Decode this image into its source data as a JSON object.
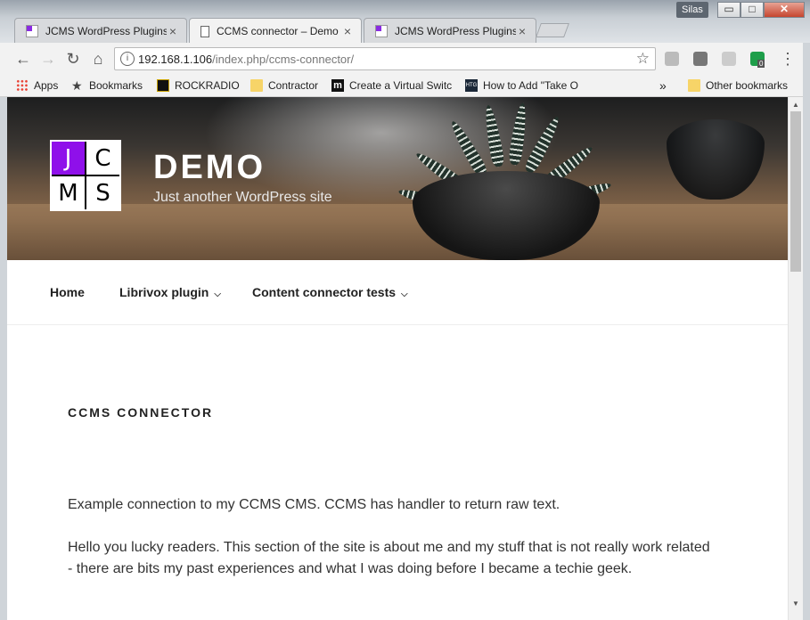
{
  "window": {
    "user_badge": "Silas",
    "controls": {
      "minimize": "▭",
      "maximize": "□",
      "close": "✕"
    }
  },
  "tabs": [
    {
      "title": "JCMS WordPress Plugins",
      "icon": "jcms-favicon",
      "active": false
    },
    {
      "title": "CCMS connector – Demo",
      "icon": "page-icon",
      "active": true
    },
    {
      "title": "JCMS WordPress Plugins",
      "icon": "jcms-favicon",
      "active": false
    }
  ],
  "toolbar": {
    "back": "←",
    "forward": "→",
    "reload": "↻",
    "home": "⌂",
    "url_host": "192.168.1.106",
    "url_path": "/index.php/ccms-connector/",
    "info": "i",
    "star": "☆",
    "menu": "⋮",
    "extensions": [
      "cube-icon",
      "shield-icon",
      "pdf-icon",
      "green-extension-icon"
    ],
    "extension_badge": "0"
  },
  "bookmarks": {
    "items": [
      {
        "label": "Apps",
        "icon": "apps-icon"
      },
      {
        "label": "Bookmarks",
        "icon": "star-icon"
      },
      {
        "label": "ROCKRADIO",
        "icon": "rockradio-icon"
      },
      {
        "label": "Contractor",
        "icon": "folder-icon"
      },
      {
        "label": "Create a Virtual Switc",
        "icon": "m-icon"
      },
      {
        "label": "How to Add \"Take O",
        "icon": "htg-icon"
      }
    ],
    "overflow": "»",
    "other": "Other bookmarks"
  },
  "site": {
    "logo_letters": [
      "J",
      "C",
      "M",
      "S"
    ],
    "title": "DEMO",
    "description": "Just another WordPress site"
  },
  "nav": [
    {
      "label": "Home",
      "has_submenu": false
    },
    {
      "label": "Librivox plugin",
      "has_submenu": true
    },
    {
      "label": "Content connector tests",
      "has_submenu": true
    }
  ],
  "content": {
    "title": "CCMS CONNECTOR",
    "paragraphs": [
      "Example connection to my CCMS CMS. CCMS has handler to return raw text.",
      "Hello you lucky readers. This section of the site is about me and my stuff that is not really work related - there are bits my past experiences and what I was doing before I became a techie geek."
    ]
  },
  "scrollbar": {
    "up": "▲",
    "down": "▼"
  }
}
